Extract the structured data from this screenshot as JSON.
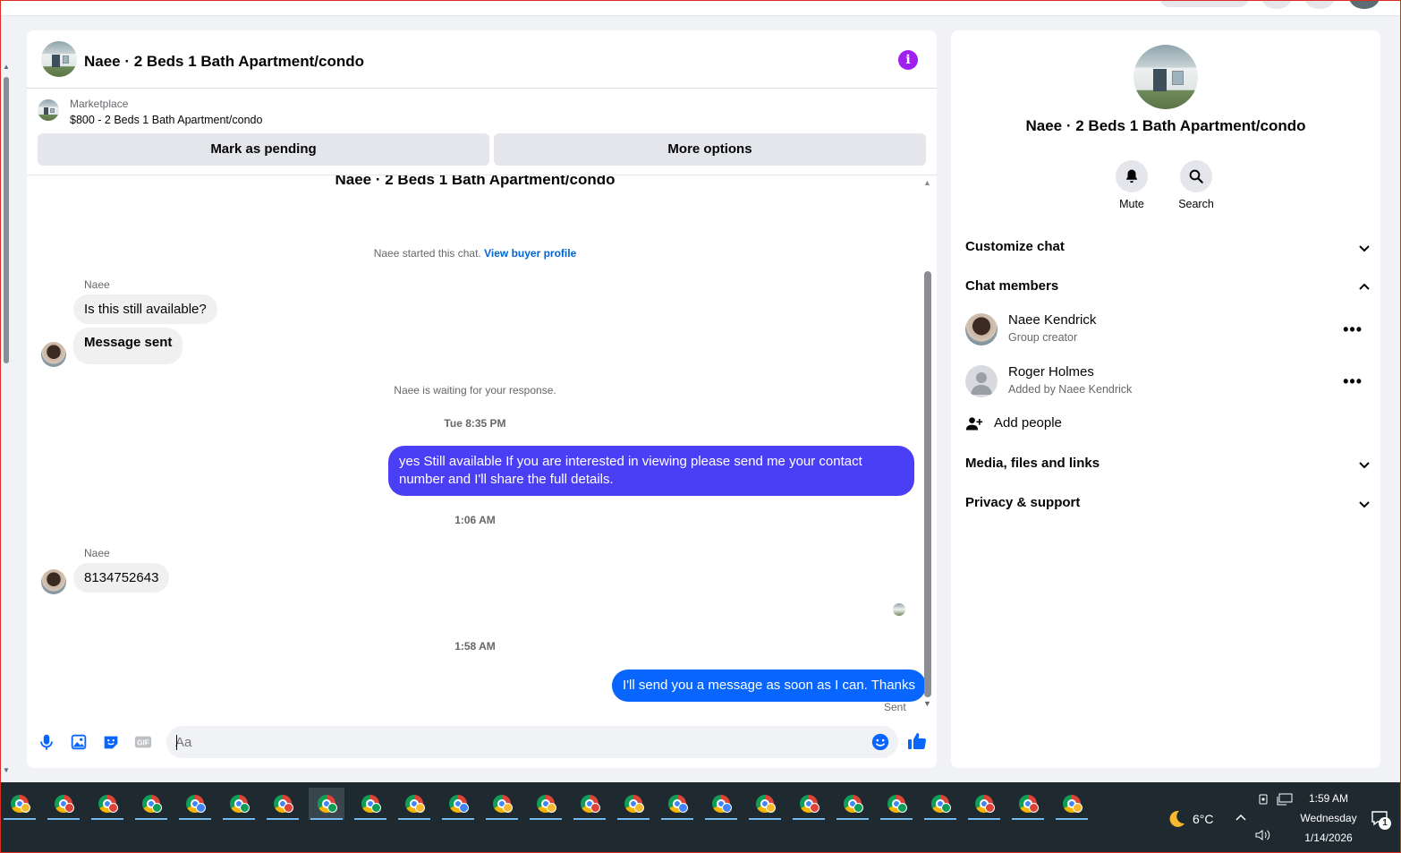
{
  "chat": {
    "title": "Naee · 2 Beds 1 Bath Apartment/condo",
    "listing_source": "Marketplace",
    "listing_price": "$800 - 2 Beds 1 Bath Apartment/condo",
    "btn_pending": "Mark as pending",
    "btn_more": "More options",
    "partial_title": "Naee · 2 Beds 1 Bath Apartment/condo",
    "started_text": "Naee started this chat.",
    "buyer_profile_link": "View buyer profile",
    "sender1": "Naee",
    "msg1": "Is this still available?",
    "msg2": "Message sent",
    "waiting_text": "Naee is waiting for your response.",
    "ts1": "Tue 8:35 PM",
    "out1": "yes Still available If you are interested in viewing please send me your contact number and I'll share the full details.",
    "ts2": "1:06 AM",
    "sender2": "Naee",
    "msg3": "8134752643",
    "ts3": "1:58 AM",
    "out2": "I'll send you a message as soon as I can. Thanks",
    "sent_label": "Sent",
    "input_placeholder": "Aa",
    "out1_color": "#4b3ff5",
    "out2_color": "#0866ff"
  },
  "details": {
    "title": "Naee · 2 Beds 1 Bath Apartment/condo",
    "mute": "Mute",
    "search": "Search",
    "customize": "Customize chat",
    "members_heading": "Chat members",
    "members": [
      {
        "name": "Naee Kendrick",
        "sub": "Group creator"
      },
      {
        "name": "Roger Holmes",
        "sub": "Added by Naee Kendrick"
      }
    ],
    "add_people": "Add people",
    "media": "Media, files and links",
    "privacy": "Privacy & support"
  },
  "taskbar": {
    "temp": "6°C",
    "time": "1:59 AM",
    "day": "Wednesday",
    "date": "1/14/2026",
    "notif_count": "1",
    "app_icon": "chrome-icon"
  }
}
